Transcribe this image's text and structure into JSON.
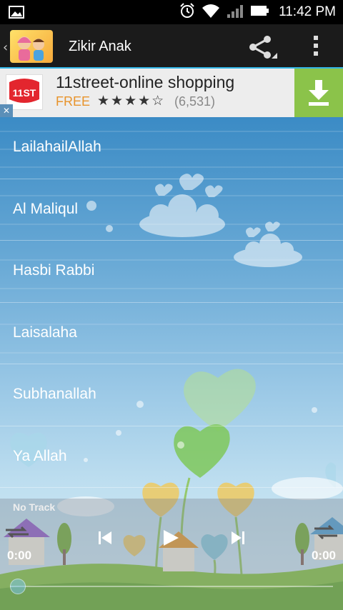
{
  "status_bar": {
    "time": "11:42 PM",
    "icons": [
      "image-icon",
      "alarm-icon",
      "wifi-icon",
      "signal-icon",
      "battery-icon"
    ]
  },
  "action_bar": {
    "title": "Zikir Anak",
    "icons": [
      "up-caret-icon",
      "app-logo",
      "share-icon",
      "overflow-menu-icon"
    ]
  },
  "ad": {
    "title": "11street-online shopping",
    "free_label": "FREE",
    "stars": "★★★★☆",
    "rating_count": "(6,531)",
    "logo_text": "11ST",
    "accent_color": "#8bc34a",
    "close_label": "✕"
  },
  "tracks": [
    {
      "label": "LailahailAllah"
    },
    {
      "label": "Al Maliqul"
    },
    {
      "label": "Hasbi Rabbi"
    },
    {
      "label": "Laisalaha"
    },
    {
      "label": "Subhanallah"
    },
    {
      "label": "Ya Allah"
    }
  ],
  "player": {
    "track_name": "No Track",
    "elapsed": "0:00",
    "remaining": "0:00",
    "progress": 0
  },
  "colors": {
    "holo_blue": "#33b5e5",
    "sky_top": "#3b8bc5"
  }
}
